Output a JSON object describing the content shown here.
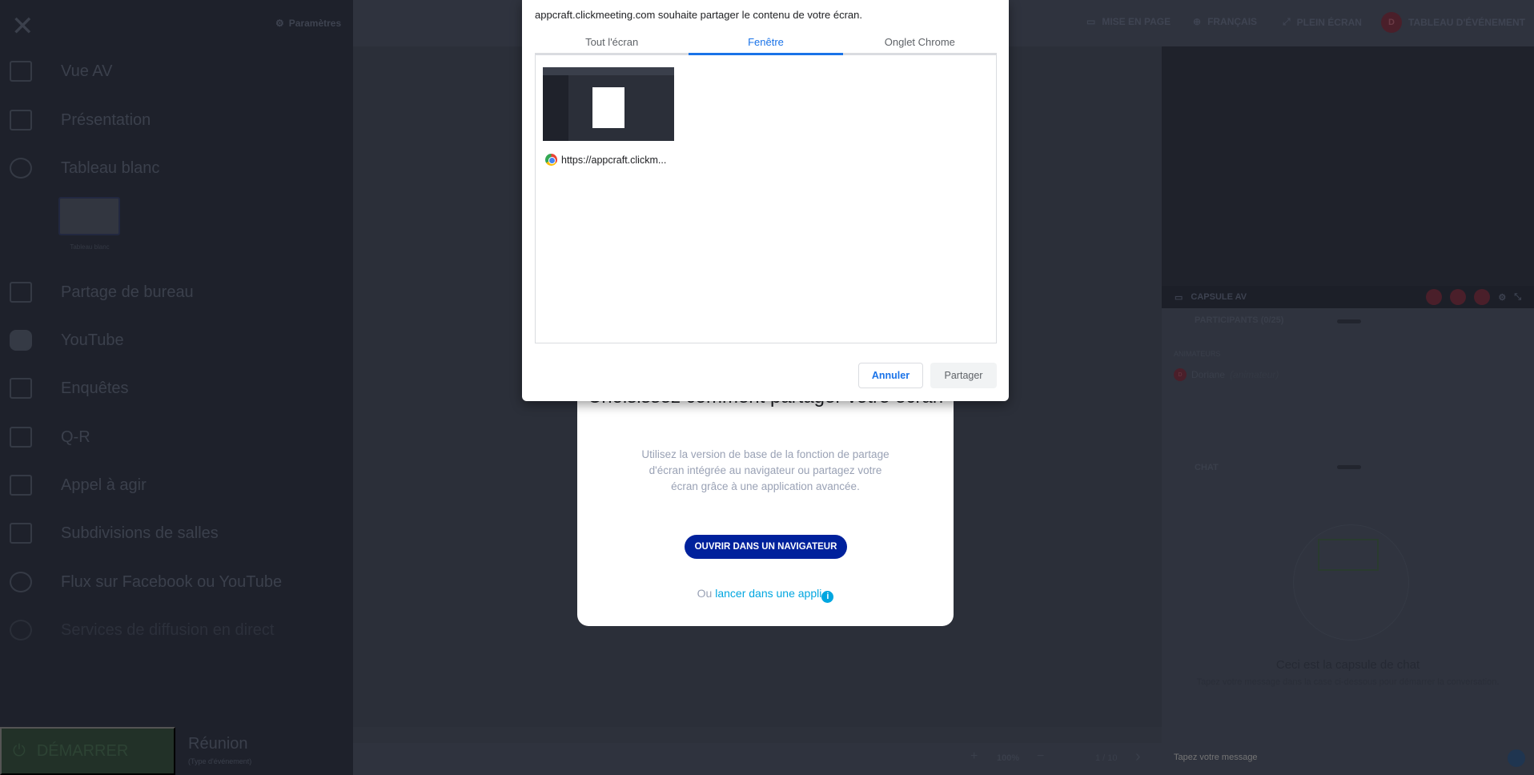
{
  "sidebar": {
    "close": "✕",
    "settings": "Paramètres",
    "items": [
      {
        "label": "Vue AV",
        "icon": "video-camera-icon"
      },
      {
        "label": "Présentation",
        "icon": "presentation-icon"
      },
      {
        "label": "Tableau blanc",
        "icon": "pencil-icon"
      },
      {
        "label": "Partage de bureau",
        "icon": "desktop-share-icon"
      },
      {
        "label": "YouTube",
        "icon": "youtube-icon"
      },
      {
        "label": "Enquêtes",
        "icon": "survey-icon"
      },
      {
        "label": "Q-R",
        "icon": "megaphone-icon"
      },
      {
        "label": "Appel à agir",
        "icon": "call-to-action-icon"
      },
      {
        "label": "Subdivisions de salles",
        "icon": "breakout-rooms-icon"
      },
      {
        "label": "Flux sur Facebook ou YouTube",
        "icon": "stream-icon"
      },
      {
        "label": "Services de diffusion en direct",
        "icon": "broadcast-icon"
      }
    ],
    "whiteboard_thumb": "Tableau blanc",
    "start": "DÉMARRER",
    "meeting_type": "Réunion",
    "meeting_sub": "(Type d'événement)"
  },
  "topbar": {
    "layout": "MISE EN PAGE",
    "language": "FRANÇAIS",
    "fullscreen": "PLEIN ÉCRAN",
    "avatar": "D",
    "event_board": "TABLEAU D'ÉVÉNEMENT"
  },
  "toolbar": {
    "zoom": "100%",
    "page": "1 / 10"
  },
  "right": {
    "capsule_av": "CAPSULE AV",
    "participants": "PARTICIPANTS (0/25)",
    "animators": "ANIMATEURS",
    "user": "Doriane",
    "user_role": "(animateur)",
    "user_initial": "D",
    "chat": "CHAT",
    "chat_title": "Ceci est la capsule de chat",
    "chat_sub": "Tapez votre message dans la case ci-dessous pour démarrer la conversation.",
    "chat_placeholder": "Tapez votre message"
  },
  "modal": {
    "title": "Choisissez comment partager votre écran",
    "desc": "Utilisez la version de base de la fonction de partage d'écran intégrée au navigateur ou partagez votre écran grâce à une application avancée.",
    "open_browser": "OUVRIR DANS UN NAVIGATEUR",
    "or": "Ou",
    "launch_app": "lancer dans une appli",
    "info": "i"
  },
  "dialog": {
    "title": "appcraft.clickmeeting.com souhaite partager le contenu de votre écran.",
    "tabs": [
      "Tout l'écran",
      "Fenêtre",
      "Onglet Chrome"
    ],
    "active_tab": "Fenêtre",
    "window_url": "https://appcraft.clickm...",
    "cancel": "Annuler",
    "share": "Partager"
  },
  "colors": {
    "accent": "#1a73e8",
    "modal_button": "#00219c",
    "link": "#00a6e0"
  }
}
